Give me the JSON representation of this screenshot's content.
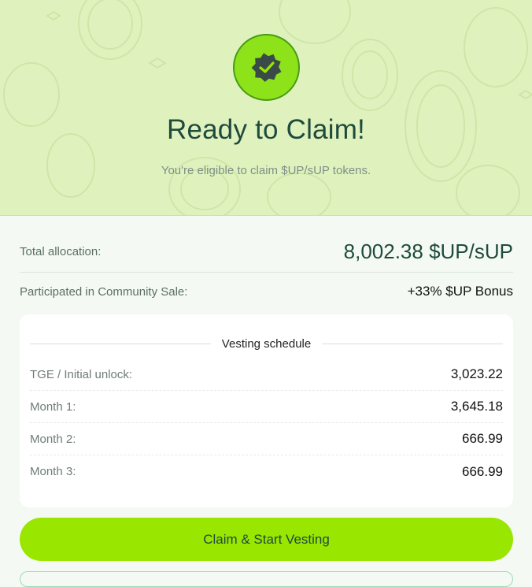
{
  "hero": {
    "title": "Ready to Claim!",
    "subtitle": "You're eligible to claim $UP/sUP tokens.",
    "badge_icon": "verified-badge-icon",
    "accent": "#99e600",
    "background": "#dff2bd"
  },
  "summary": {
    "total_label": "Total allocation:",
    "total_value": "8,002.38 $UP/sUP",
    "sale_label": "Participated in Community Sale:",
    "sale_value": "+33% $UP Bonus"
  },
  "vesting": {
    "heading": "Vesting schedule",
    "rows": [
      {
        "label": "TGE / Initial unlock:",
        "value": "3,023.22"
      },
      {
        "label": "Month 1:",
        "value": "3,645.18"
      },
      {
        "label": "Month 2:",
        "value": "666.99"
      },
      {
        "label": "Month 3:",
        "value": "666.99"
      }
    ]
  },
  "actions": {
    "claim_label": "Claim & Start Vesting"
  }
}
